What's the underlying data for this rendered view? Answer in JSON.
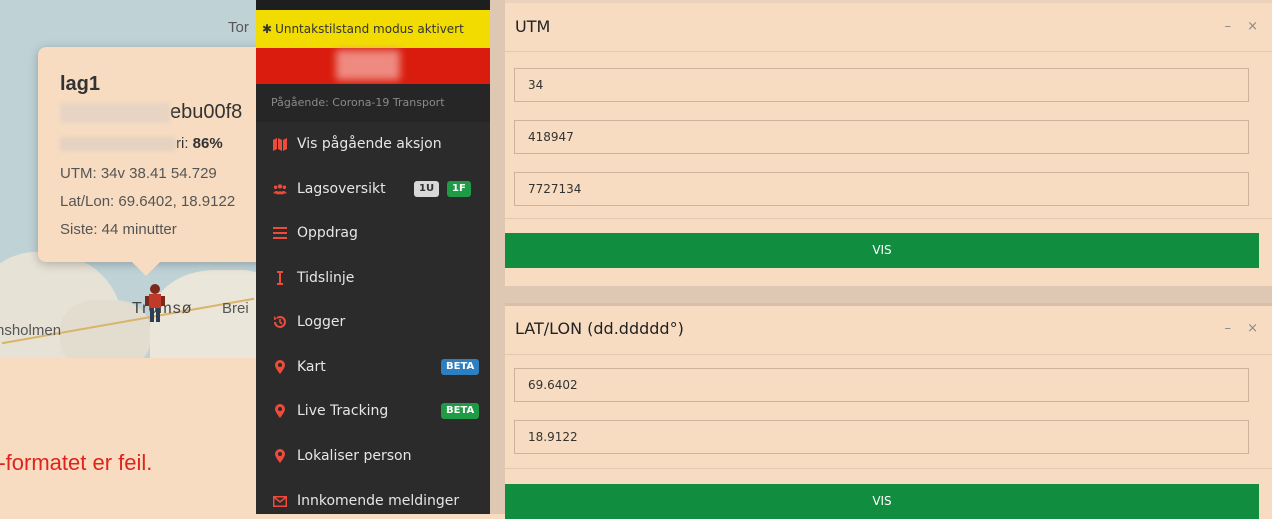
{
  "map": {
    "labels": {
      "tor": "Tor",
      "tromso": "Tromsø",
      "brei": "Brei",
      "holmen": "nsholmen"
    },
    "popup": {
      "title": "lag1",
      "id_suffix": "ebu00f8",
      "battery_label": "ri: ",
      "battery_value": "86%",
      "utm": "UTM: 34v 38.41 54.729",
      "latlon": "Lat/Lon: 69.6402, 18.9122",
      "last_seen": "Siste: 44 minutter"
    }
  },
  "error": {
    "line1": "M-formatet er feil.",
    "line2": ""
  },
  "sidebar": {
    "emergency_banner": "Unntakstilstand modus aktivert",
    "ongoing": "Pågående: Corona-19 Transport",
    "items": [
      {
        "label": "Vis pågående aksjon",
        "icon": "map-icon"
      },
      {
        "label": "Lagsoversikt",
        "icon": "users-icon",
        "badges": [
          "1U",
          "1F"
        ]
      },
      {
        "label": "Oppdrag",
        "icon": "list-icon"
      },
      {
        "label": "Tidslinje",
        "icon": "timeline-icon"
      },
      {
        "label": "Logger",
        "icon": "history-icon"
      },
      {
        "label": "Kart",
        "icon": "map-marker-icon",
        "badge": "BETA"
      },
      {
        "label": "Live Tracking",
        "icon": "map-marker-icon",
        "badge": "BETA"
      },
      {
        "label": "Lokaliser person",
        "icon": "map-marker-icon"
      },
      {
        "label": "Innkomende meldinger",
        "icon": "envelope-icon"
      }
    ]
  },
  "panels": {
    "utm": {
      "title": "UTM",
      "fields": [
        "34",
        "418947",
        "7727134"
      ],
      "button": "VIS"
    },
    "latlon": {
      "title": "LAT/LON (dd.ddddd°)",
      "fields": [
        "69.6402",
        "18.9122"
      ],
      "button": "VIS"
    },
    "controls": {
      "minimize": "–",
      "close": "×"
    }
  },
  "colors": {
    "panel_bg": "#f7dcc1",
    "sidebar_bg": "#2b2b2b",
    "emergency_yellow": "#f2dc00",
    "alert_red": "#d91c0e",
    "button_green": "#118d3f",
    "icon_red": "#ee4b3b",
    "error_text": "#e0241c"
  }
}
